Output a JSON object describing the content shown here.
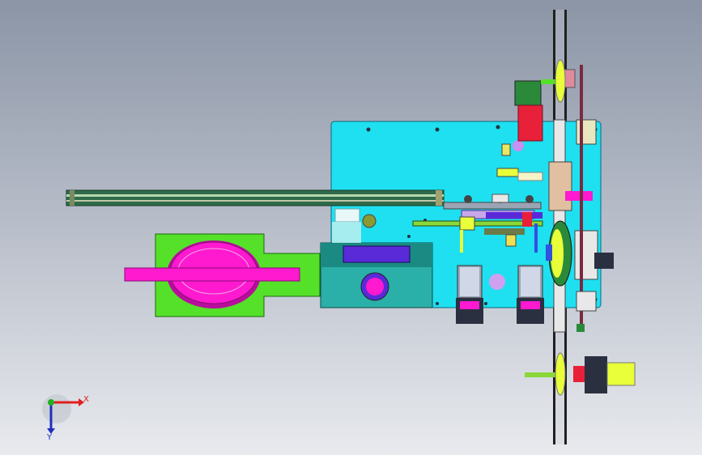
{
  "colors": {
    "plate": "#1ee0f0",
    "rail": "#2f6b4a",
    "green_plate": "#55e02a",
    "magenta": "#ff1ad0",
    "teal_box": "#2ab0a8",
    "yellow": "#e8ff3a",
    "red": "#e8203a",
    "purple": "#5a2ad8",
    "grey": "#9aa4b4",
    "dark": "#2a3040",
    "pink": "#e08aa0",
    "axis_x": "#e02020",
    "axis_y": "#2030c0",
    "axis_origin": "#20b020"
  },
  "triad": {
    "x_label": "X",
    "y_label": "Y"
  }
}
